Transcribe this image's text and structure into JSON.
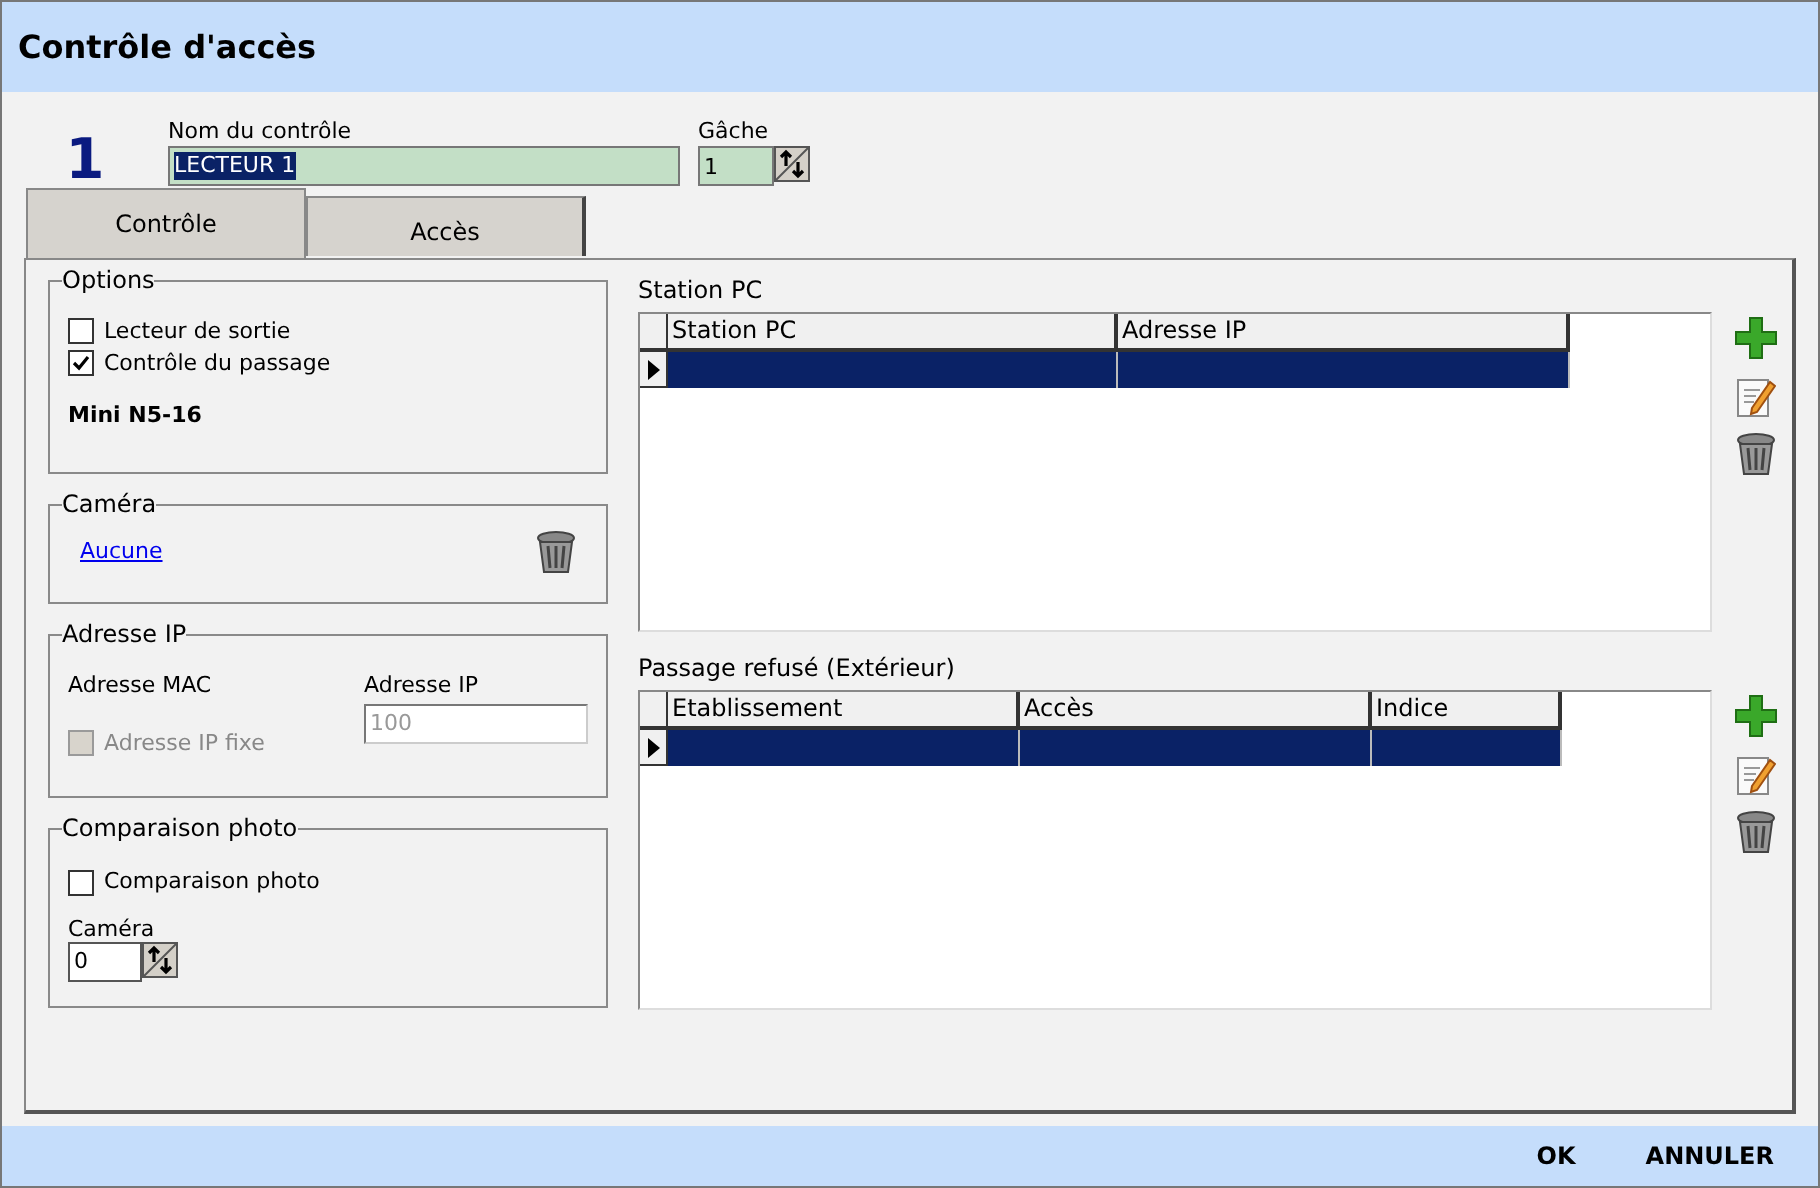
{
  "window": {
    "title": "Contrôle d'accès"
  },
  "header": {
    "number": "1",
    "name_label": "Nom du contrôle",
    "name_value": "LECTEUR 1",
    "gache_label": "Gâche",
    "gache_value": "1"
  },
  "tabs": [
    {
      "label": "Contrôle",
      "selected": true
    },
    {
      "label": "Accès",
      "selected": false
    }
  ],
  "options": {
    "title": "Options",
    "checkboxes": [
      {
        "label": "Lecteur de sortie",
        "checked": false
      },
      {
        "label": "Contrôle du passage",
        "checked": true
      }
    ],
    "model": "Mini N5-16"
  },
  "camera": {
    "title": "Caméra",
    "link": "Aucune"
  },
  "ip": {
    "title": "Adresse IP",
    "mac_label": "Adresse MAC",
    "ip_label": "Adresse IP",
    "ip_placeholder": "100",
    "fixed": {
      "label": "Adresse IP fixe",
      "checked": false,
      "disabled": true
    }
  },
  "photo": {
    "title": "Comparaison photo",
    "checkbox": {
      "label": "Comparaison photo",
      "checked": false
    },
    "camera_label": "Caméra",
    "camera_value": "0"
  },
  "tables": [
    {
      "title": "Station PC",
      "columns": [
        {
          "label": "Station PC"
        },
        {
          "label": "Adresse IP"
        }
      ],
      "rows": [
        {
          "selected": true
        }
      ]
    },
    {
      "title": "Passage refusé (Extérieur)",
      "columns": [
        {
          "label": "Etablissement"
        },
        {
          "label": "Accès"
        },
        {
          "label": "Indice"
        }
      ],
      "rows": [
        {
          "selected": true
        }
      ]
    }
  ],
  "footer": {
    "buttons": [
      "OK",
      "ANNULER"
    ]
  }
}
